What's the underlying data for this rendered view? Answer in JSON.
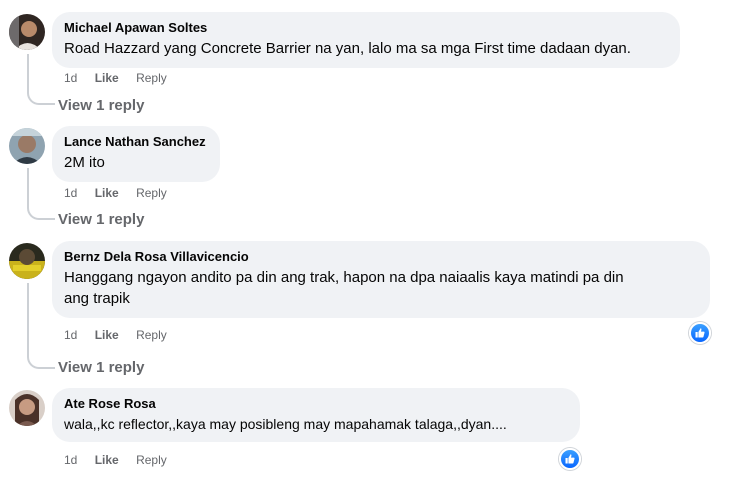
{
  "comments": [
    {
      "author": "Michael Apawan Soltes",
      "text": "Road Hazzard yang Concrete Barrier na yan, lalo ma sa mga First time dadaan dyan.",
      "time": "1d",
      "like": "Like",
      "reply": "Reply",
      "view_replies": "View 1 reply"
    },
    {
      "author": "Lance Nathan Sanchez",
      "text": "2M ito",
      "time": "1d",
      "like": "Like",
      "reply": "Reply",
      "view_replies": "View 1 reply"
    },
    {
      "author": "Bernz Dela Rosa Villavicencio",
      "text_line1": "Hanggang ngayon andito pa din ang trak, hapon na dpa naiaalis kaya matindi pa din",
      "text_line2": "ang trapik",
      "time": "1d",
      "like": "Like",
      "reply": "Reply",
      "view_replies": "View 1 reply",
      "reaction": "like-reaction-icon"
    },
    {
      "author": "Ate Rose Rosa",
      "text": "wala,,kc reflector,,kaya may posibleng may mapahamak talaga,,dyan....",
      "time": "1d",
      "like": "Like",
      "reply": "Reply",
      "reaction": "like-reaction-icon"
    }
  ],
  "colors": {
    "bubble": "#f0f2f5",
    "secondary_text": "#65676b",
    "reaction_blue": "#0866ff"
  }
}
